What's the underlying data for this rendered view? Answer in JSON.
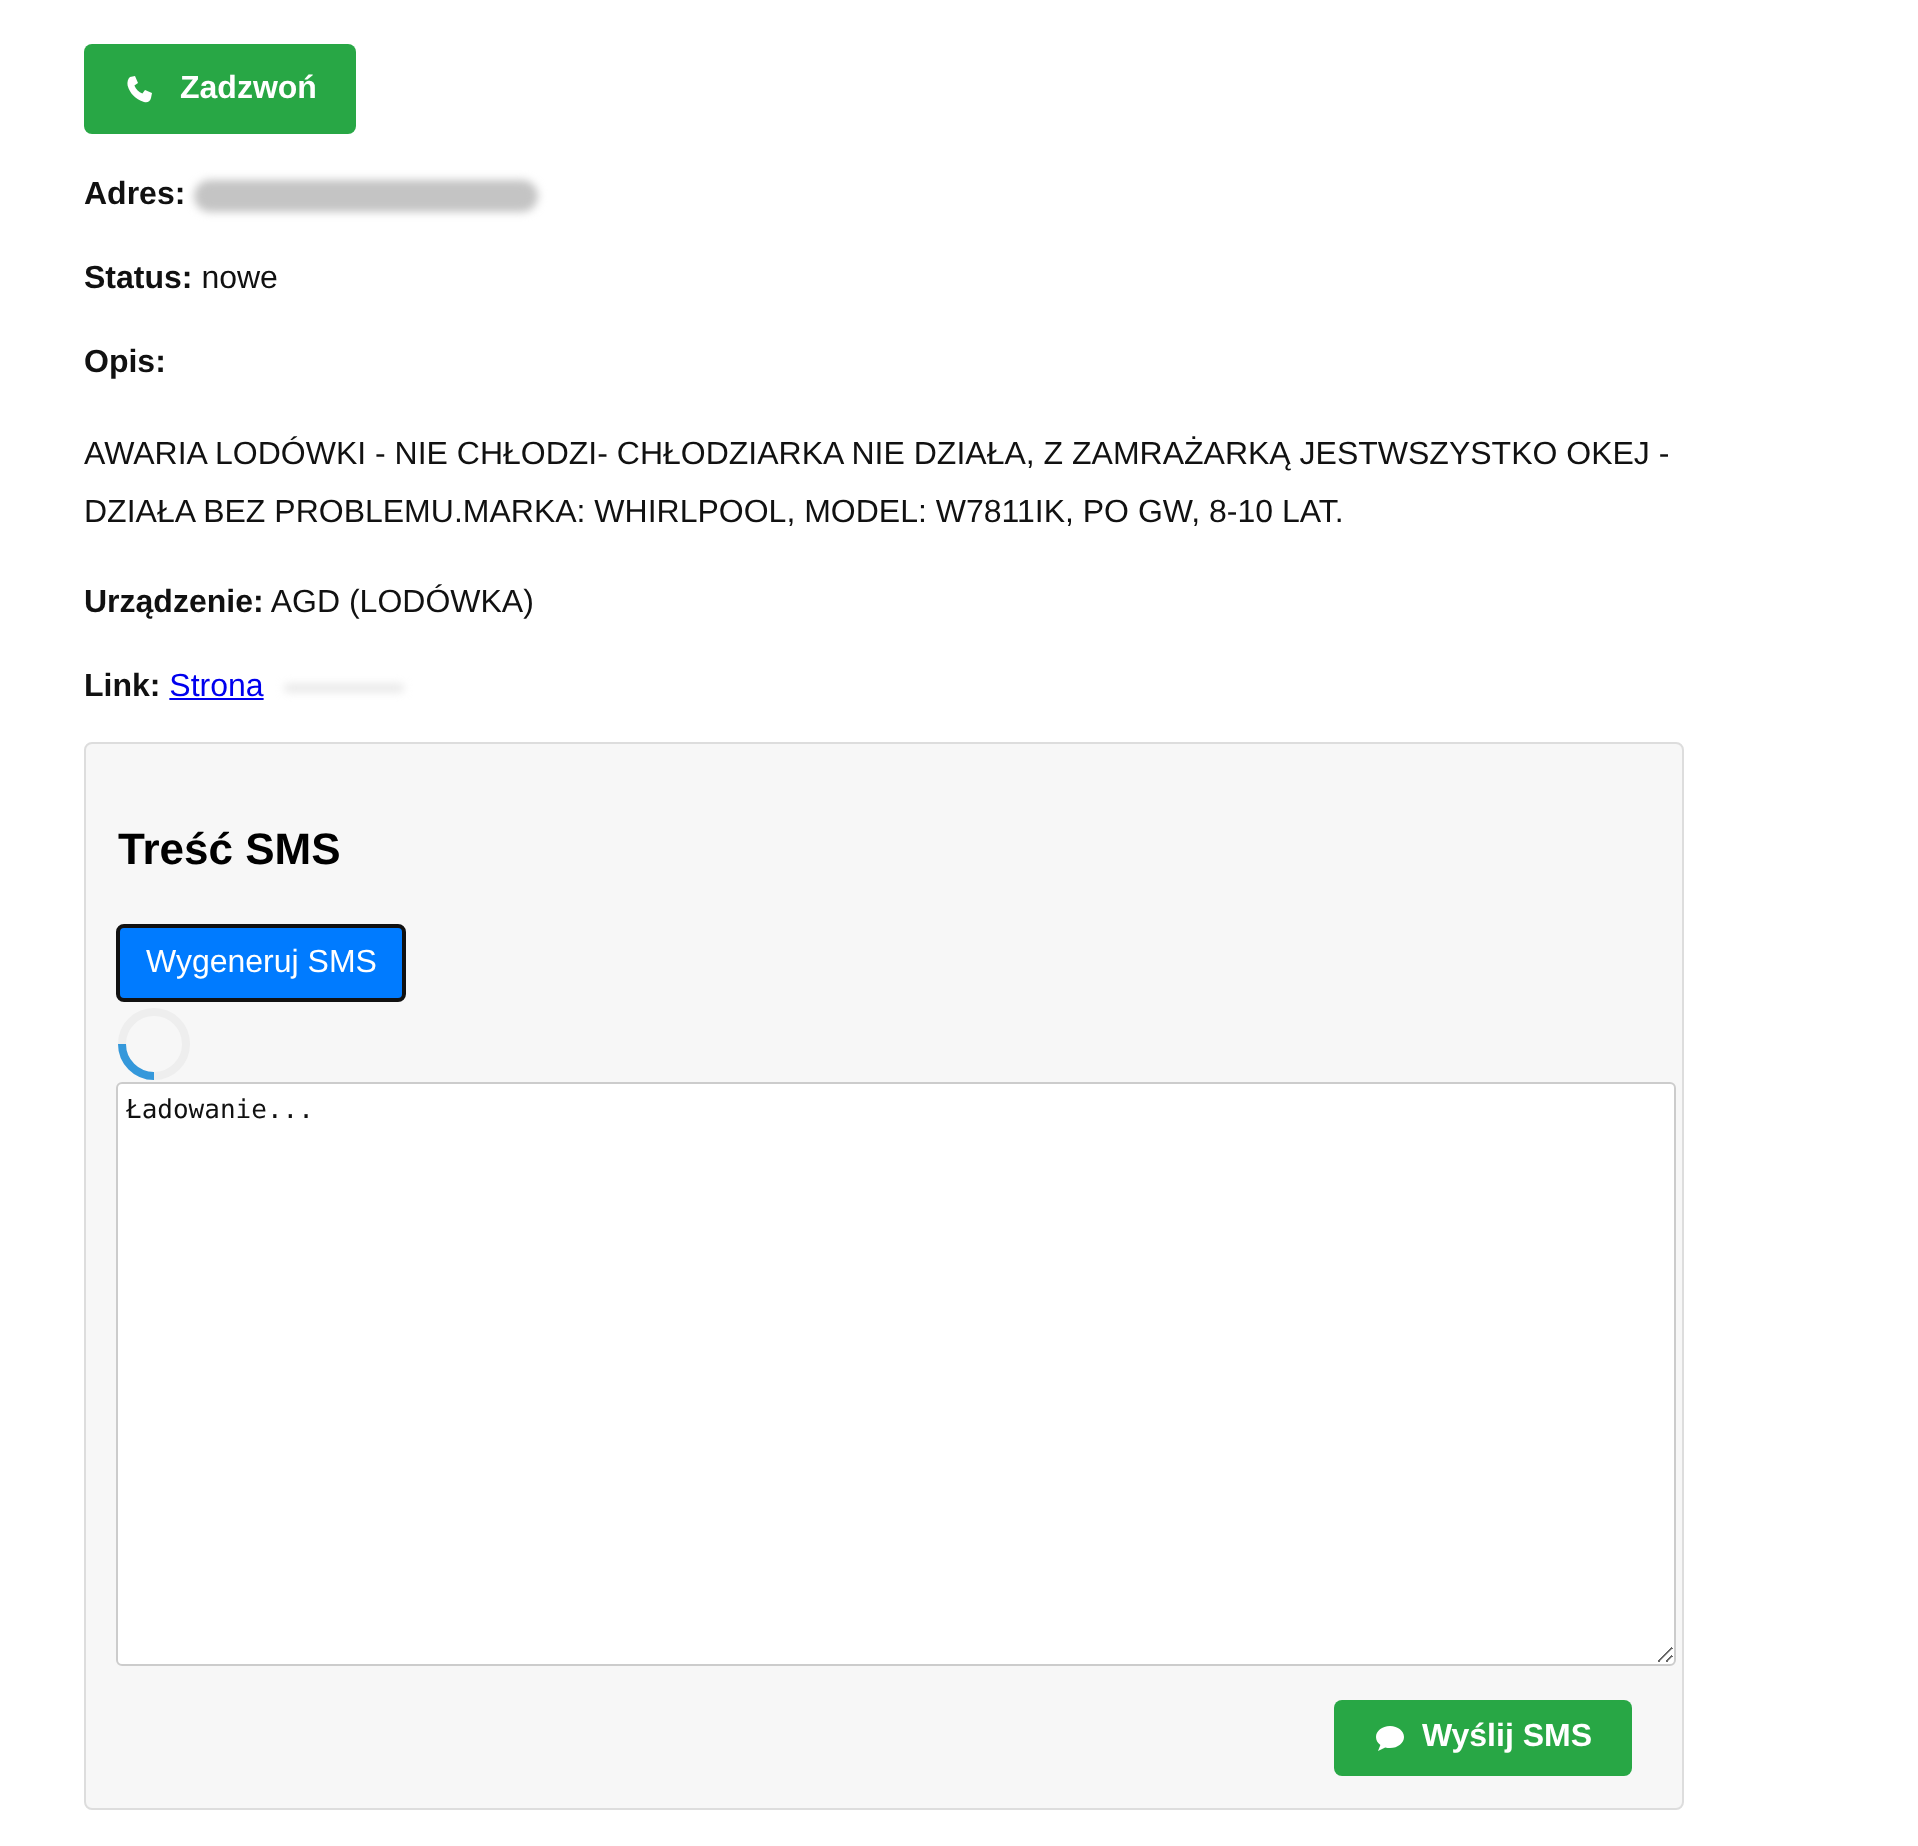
{
  "call_button": {
    "label": "Zadzwoń"
  },
  "fields": [
    {
      "kind": "redacted",
      "label": "Adres:"
    },
    {
      "kind": "text",
      "label": "Status:",
      "value": "nowe"
    },
    {
      "kind": "heading",
      "label": "Opis:"
    },
    {
      "kind": "paragraph",
      "value": "AWARIA LODÓWKI - NIE CHŁODZI- CHŁODZIARKA NIE DZIAŁA, Z ZAMRAŻARKĄ JESTWSZYSTKO OKEJ - DZIAŁA BEZ PROBLEMU.MARKA: WHIRLPOOL, MODEL: W7811IK, PO GW, 8-10 LAT."
    },
    {
      "kind": "text",
      "label": "Urządzenie:",
      "value": "AGD (LODÓWKA)"
    },
    {
      "kind": "link",
      "label": "Link:",
      "value": "Strona"
    }
  ],
  "sms_panel": {
    "title": "Treść SMS",
    "generate_button": "Wygeneruj SMS",
    "loading": true,
    "message": "Ładowanie...",
    "send_button": "Wyślij SMS"
  }
}
